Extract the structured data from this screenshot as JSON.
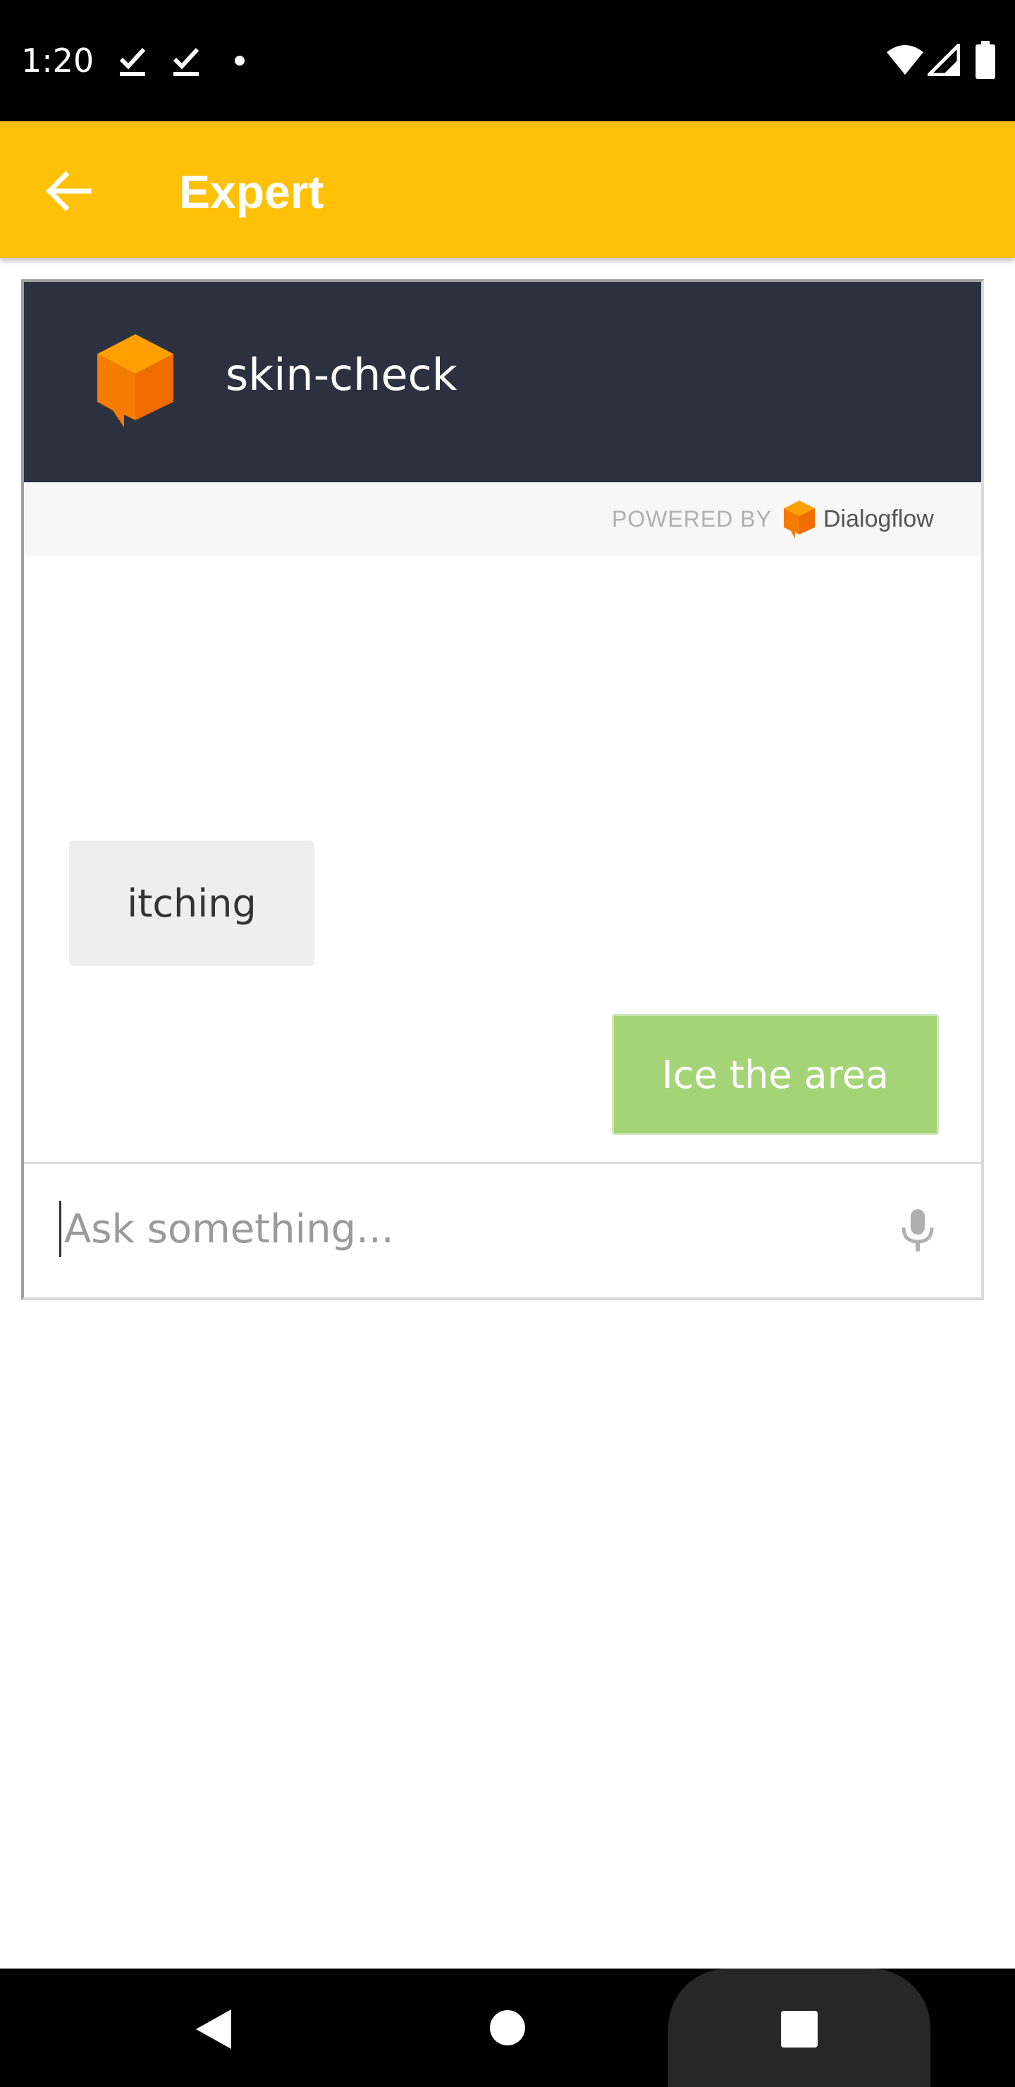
{
  "status_bar": {
    "time": "1:20",
    "left_icons": [
      "check-download-icon",
      "check-download-icon",
      "dot-icon"
    ],
    "right_icons": [
      "wifi-icon",
      "cell-signal-icon",
      "battery-icon"
    ]
  },
  "app_bar": {
    "title": "Expert",
    "back_icon": "arrow-left-icon",
    "color": "#FFC107"
  },
  "chat": {
    "bot_name": "skin-check",
    "header_color": "#2C3140",
    "powered_by": "POWERED BY",
    "brand": "Dialogflow",
    "brand_color": "#FF8A00",
    "messages": [
      {
        "from": "bot",
        "text": "itching"
      },
      {
        "from": "user",
        "text": "Ice the area",
        "color": "#A5D476"
      }
    ],
    "input": {
      "placeholder": "Ask something...",
      "value": ""
    },
    "mic_icon": "microphone-icon"
  },
  "nav_bar": {
    "buttons": [
      "back-triangle-icon",
      "home-circle-icon",
      "recents-square-icon"
    ]
  }
}
